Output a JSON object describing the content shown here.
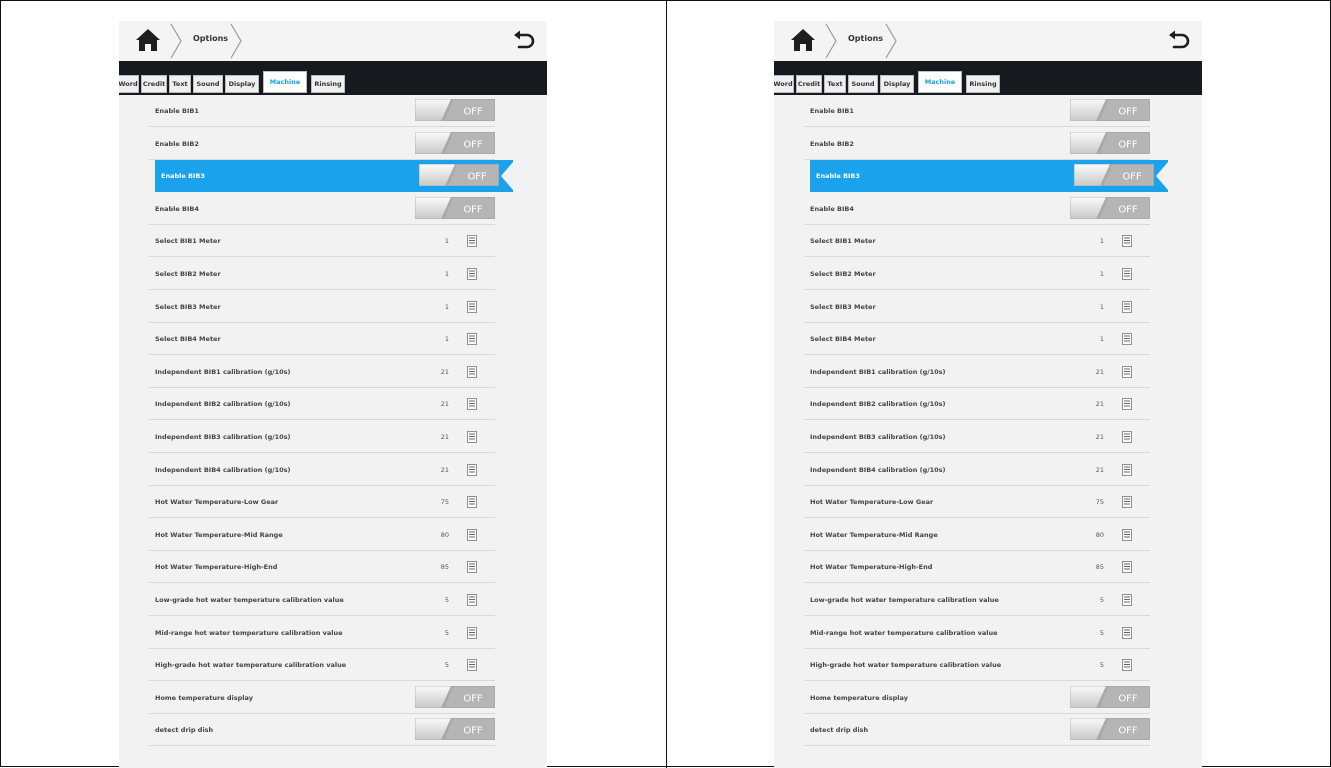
{
  "header": {
    "breadcrumb": "Options"
  },
  "tabs": [
    {
      "label": "Word"
    },
    {
      "label": "Credit"
    },
    {
      "label": "Text"
    },
    {
      "label": "Sound"
    },
    {
      "label": "Display"
    },
    {
      "label": "Machine",
      "active": true
    },
    {
      "label": "Rinsing"
    }
  ],
  "toggle_off_label": "OFF",
  "colors": {
    "accent": "#1aa3ec",
    "tabbar": "#161a1e",
    "active_tab_text": "#1aa0e0"
  },
  "icons": {
    "home": "home-icon",
    "back": "back-arrow-icon",
    "list": "list-icon"
  },
  "panels": [
    {
      "rows": [
        {
          "label": "Enable BIB1",
          "type": "toggle",
          "state": "OFF"
        },
        {
          "label": "Enable BIB2",
          "type": "toggle",
          "state": "OFF"
        },
        {
          "label": "Enable BIB3",
          "type": "toggle",
          "state": "OFF",
          "selected": true
        },
        {
          "label": "Enable BIB4",
          "type": "toggle",
          "state": "OFF"
        },
        {
          "label": "Select BIB1 Meter",
          "type": "value",
          "value": "1"
        },
        {
          "label": "Select BIB2 Meter",
          "type": "value",
          "value": "1"
        },
        {
          "label": "Select BIB3 Meter",
          "type": "value",
          "value": "1"
        },
        {
          "label": "Select BIB4 Meter",
          "type": "value",
          "value": "1"
        },
        {
          "label": "Independent BIB1 calibration (g/10s)",
          "type": "value",
          "value": "21"
        },
        {
          "label": "Independent BIB2 calibration (g/10s)",
          "type": "value",
          "value": "21"
        },
        {
          "label": "Independent BIB3 calibration (g/10s)",
          "type": "value",
          "value": "21"
        },
        {
          "label": "Independent BIB4 calibration (g/10s)",
          "type": "value",
          "value": "21"
        },
        {
          "label": "Hot Water Temperature-Low Gear",
          "type": "value",
          "value": "75"
        },
        {
          "label": "Hot Water Temperature-Mid Range",
          "type": "value",
          "value": "80"
        },
        {
          "label": "Hot Water Temperature-High-End",
          "type": "value",
          "value": "85"
        },
        {
          "label": "Low-grade hot water temperature calibration value",
          "type": "value",
          "value": "5"
        },
        {
          "label": "Mid-range hot water temperature calibration value",
          "type": "value",
          "value": "5"
        },
        {
          "label": "High-grade hot water temperature calibration value",
          "type": "value",
          "value": "5"
        },
        {
          "label": "Home temperature display",
          "type": "toggle",
          "state": "OFF"
        },
        {
          "label": "detect drip dish",
          "type": "toggle",
          "state": "OFF"
        }
      ]
    },
    {
      "rows": [
        {
          "label": "Enable BIB1",
          "type": "toggle",
          "state": "OFF"
        },
        {
          "label": "Enable BIB2",
          "type": "toggle",
          "state": "OFF"
        },
        {
          "label": "Enable BIB3",
          "type": "toggle",
          "state": "OFF",
          "selected": true
        },
        {
          "label": "Enable BIB4",
          "type": "toggle",
          "state": "OFF"
        },
        {
          "label": "Select BIB1 Meter",
          "type": "value",
          "value": "1"
        },
        {
          "label": "Select BIB2 Meter",
          "type": "value",
          "value": "1"
        },
        {
          "label": "Select BIB3 Meter",
          "type": "value",
          "value": "1"
        },
        {
          "label": "Select BIB4 Meter",
          "type": "value",
          "value": "1"
        },
        {
          "label": "Independent BIB1 calibration (g/10s)",
          "type": "value",
          "value": "21"
        },
        {
          "label": "Independent BIB2 calibration (g/10s)",
          "type": "value",
          "value": "21"
        },
        {
          "label": "Independent BIB3 calibration (g/10s)",
          "type": "value",
          "value": "21"
        },
        {
          "label": "Independent BIB4 calibration (g/10s)",
          "type": "value",
          "value": "21"
        },
        {
          "label": "Hot Water Temperature-Low Gear",
          "type": "value",
          "value": "75"
        },
        {
          "label": "Hot Water Temperature-Mid Range",
          "type": "value",
          "value": "80"
        },
        {
          "label": "Hot Water Temperature-High-End",
          "type": "value",
          "value": "85"
        },
        {
          "label": "Low-grade hot water temperature calibration value",
          "type": "value",
          "value": "5"
        },
        {
          "label": "Mid-range hot water temperature calibration value",
          "type": "value",
          "value": "5"
        },
        {
          "label": "High-grade hot water temperature calibration value",
          "type": "value",
          "value": "5"
        },
        {
          "label": "Home temperature display",
          "type": "toggle",
          "state": "OFF"
        },
        {
          "label": "detect drip dish",
          "type": "toggle",
          "state": "OFF"
        }
      ]
    }
  ]
}
